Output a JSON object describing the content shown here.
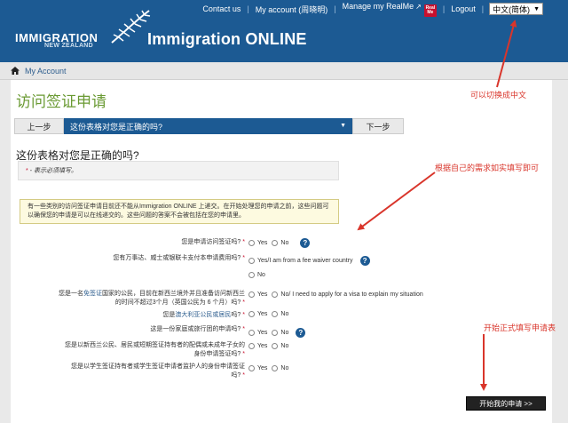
{
  "header": {
    "logo_line1": "IMMIGRATION",
    "logo_line2": "NEW ZEALAND",
    "app_title": "Immigration ONLINE",
    "nav": {
      "contact": "Contact us",
      "account": "My account (周晓明)",
      "realme": "Manage my RealMe",
      "realme_badge_1": "Real",
      "realme_badge_2": "Me",
      "logout": "Logout",
      "language": "中文(简体)"
    }
  },
  "breadcrumb": {
    "label": "My Account"
  },
  "page": {
    "title": "访问签证申请",
    "steps": {
      "prev": "上一步",
      "current": "这份表格对您是正确的吗?",
      "next": "下一步"
    },
    "section_heading": "这份表格对您是正确的吗?",
    "required_note_star": "*",
    "required_note": " - 表示必须填写。",
    "notice": "有一些类别的访问签证申请目前还不能从Immigration ONLINE 上递交。在开始处理您的申请之前，这些问题可以确保您的申请是可以在线递交的。这些问题的答案不会被包括在您的申请里。",
    "questions": [
      {
        "label": "您是申请访问签证吗?",
        "options": [
          "Yes",
          "No"
        ]
      },
      {
        "label": "您有万事达、威士或银联卡支付本申请费用吗?",
        "options": [
          "Yes/I am from a fee waiver country",
          "No"
        ]
      },
      {
        "label_pre": "您是一名",
        "label_link": "免签证",
        "label_post": "国家的公民，目前在新西兰境外并且准备访问新西兰的时间不超过3个月（英国公民为 6 个月）吗?",
        "options": [
          "Yes",
          "No/ I need to apply for a visa to explain my situation"
        ]
      },
      {
        "label_pre": "您是",
        "label_link": "澳大利亚公民或居民",
        "label_post": "吗?",
        "options": [
          "Yes",
          "No"
        ]
      },
      {
        "label": "这是一份家庭或旅行团的申请吗?",
        "options": [
          "Yes",
          "No"
        ]
      },
      {
        "label": "您是以新西兰公民、居民或短期签证持有者的配偶或未成年子女的身份申请签证吗?",
        "options": [
          "Yes",
          "No"
        ]
      },
      {
        "label": "您是以学生签证持有者或学生签证申请者监护人的身份申请签证吗?",
        "options": [
          "Yes",
          "No"
        ]
      }
    ],
    "required_star": "*",
    "start_button": "开始我的申请 >>"
  },
  "annotations": {
    "switch_language": "可以切换成中文",
    "fill_truthfully": "根据自己的需求如实填写即可",
    "start_filling": "开始正式填写申请表"
  },
  "colors": {
    "brand_blue": "#1c5a93",
    "title_green": "#6a9a33",
    "annotation_red": "#d9352b"
  },
  "icons": [
    "fern-icon",
    "external-link-icon",
    "home-icon",
    "help-icon",
    "chevron-down-icon"
  ]
}
